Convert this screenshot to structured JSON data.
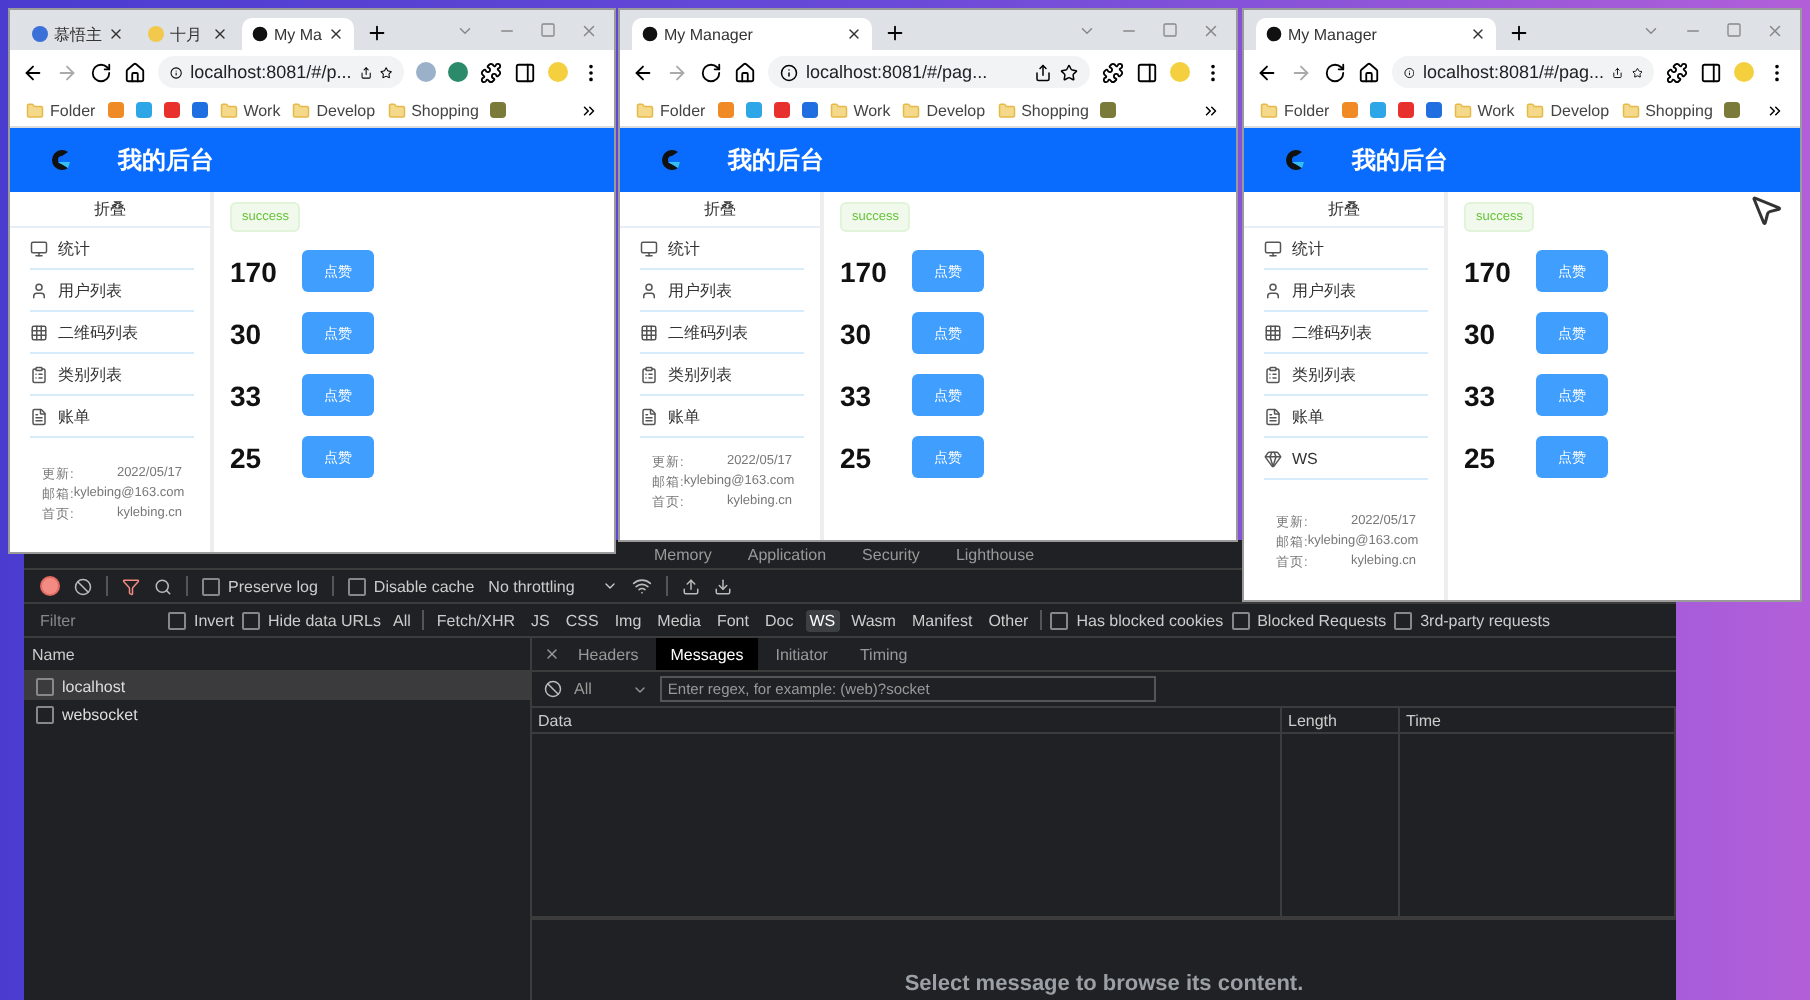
{
  "windows": [
    {
      "tabs": [
        {
          "title": "慕悟主",
          "selected": false
        },
        {
          "title": "十月",
          "selected": false
        },
        {
          "title": "My Ma",
          "selected": true
        }
      ],
      "address": "localhost:8081/#/p...",
      "bookmarks": [
        "Folder",
        "Work",
        "Develop",
        "Shopping"
      ],
      "app": {
        "title": "我的后台",
        "collapse": "折叠",
        "menu": [
          "统计",
          "用户列表",
          "二维码列表",
          "类别列表",
          "账单"
        ],
        "footer": [
          {
            "label": "更新:",
            "value": "2022/05/17"
          },
          {
            "label": "邮箱:",
            "value": "kylebing@163.com"
          },
          {
            "label": "首页:",
            "value": "kylebing.cn"
          }
        ],
        "tag": "success",
        "counters": [
          {
            "count": "170",
            "button": "点赞"
          },
          {
            "count": "30",
            "button": "点赞"
          },
          {
            "count": "33",
            "button": "点赞"
          },
          {
            "count": "25",
            "button": "点赞"
          }
        ]
      }
    },
    {
      "tabs": [
        {
          "title": "My Manager",
          "selected": true
        }
      ],
      "address": "localhost:8081/#/pag...",
      "bookmarks": [
        "Folder",
        "Work",
        "Develop",
        "Shopping"
      ],
      "app": {
        "title": "我的后台",
        "collapse": "折叠",
        "menu": [
          "统计",
          "用户列表",
          "二维码列表",
          "类别列表",
          "账单"
        ],
        "footer": [
          {
            "label": "更新:",
            "value": "2022/05/17"
          },
          {
            "label": "邮箱:",
            "value": "kylebing@163.com"
          },
          {
            "label": "首页:",
            "value": "kylebing.cn"
          }
        ],
        "tag": "success",
        "counters": [
          {
            "count": "170",
            "button": "点赞"
          },
          {
            "count": "30",
            "button": "点赞"
          },
          {
            "count": "33",
            "button": "点赞"
          },
          {
            "count": "25",
            "button": "点赞"
          }
        ]
      }
    },
    {
      "tabs": [
        {
          "title": "My Manager",
          "selected": true
        }
      ],
      "address": "localhost:8081/#/pag...",
      "bookmarks": [
        "Folder",
        "Work",
        "Develop",
        "Shopping"
      ],
      "app": {
        "title": "我的后台",
        "collapse": "折叠",
        "menu": [
          "统计",
          "用户列表",
          "二维码列表",
          "类别列表",
          "账单",
          "WS"
        ],
        "footer": [
          {
            "label": "更新:",
            "value": "2022/05/17"
          },
          {
            "label": "邮箱:",
            "value": "kylebing@163.com"
          },
          {
            "label": "首页:",
            "value": "kylebing.cn"
          }
        ],
        "tag": "success",
        "counters": [
          {
            "count": "170",
            "button": "点赞"
          },
          {
            "count": "30",
            "button": "点赞"
          },
          {
            "count": "33",
            "button": "点赞"
          },
          {
            "count": "25",
            "button": "点赞"
          }
        ]
      }
    }
  ],
  "devtools": {
    "panel_tabs": [
      "Memory",
      "Application",
      "Security",
      "Lighthouse"
    ],
    "toolbar": {
      "preserve_log": {
        "label": "Preserve log",
        "checked": false
      },
      "disable_cache": {
        "label": "Disable cache",
        "checked": false
      },
      "throttling": "No throttling"
    },
    "filter": {
      "placeholder": "Filter",
      "options": [
        {
          "label": "Invert",
          "checked": false
        },
        {
          "label": "Hide data URLs",
          "checked": false
        }
      ],
      "types": [
        {
          "label": "All",
          "selected": false
        },
        {
          "label": "Fetch/XHR",
          "selected": false
        },
        {
          "label": "JS",
          "selected": false
        },
        {
          "label": "CSS",
          "selected": false
        },
        {
          "label": "Img",
          "selected": false
        },
        {
          "label": "Media",
          "selected": false
        },
        {
          "label": "Font",
          "selected": false
        },
        {
          "label": "Doc",
          "selected": false
        },
        {
          "label": "WS",
          "selected": true
        },
        {
          "label": "Wasm",
          "selected": false
        },
        {
          "label": "Manifest",
          "selected": false
        },
        {
          "label": "Other",
          "selected": false
        }
      ],
      "extra_options": [
        {
          "label": "Has blocked cookies",
          "checked": false
        },
        {
          "label": "Blocked Requests",
          "checked": false
        },
        {
          "label": "3rd-party requests",
          "checked": false
        }
      ]
    },
    "requests": {
      "column": "Name",
      "rows": [
        {
          "name": "localhost",
          "selected": true
        },
        {
          "name": "websocket",
          "selected": false
        }
      ]
    },
    "detail": {
      "tabs": [
        {
          "label": "Headers",
          "selected": false
        },
        {
          "label": "Messages",
          "selected": true
        },
        {
          "label": "Initiator",
          "selected": false
        },
        {
          "label": "Timing",
          "selected": false
        }
      ],
      "message_type": "All",
      "search_placeholder": "Enter regex, for example: (web)?socket",
      "columns": [
        "Data",
        "Length",
        "Time"
      ],
      "empty_text": "Select message to browse its content."
    }
  }
}
